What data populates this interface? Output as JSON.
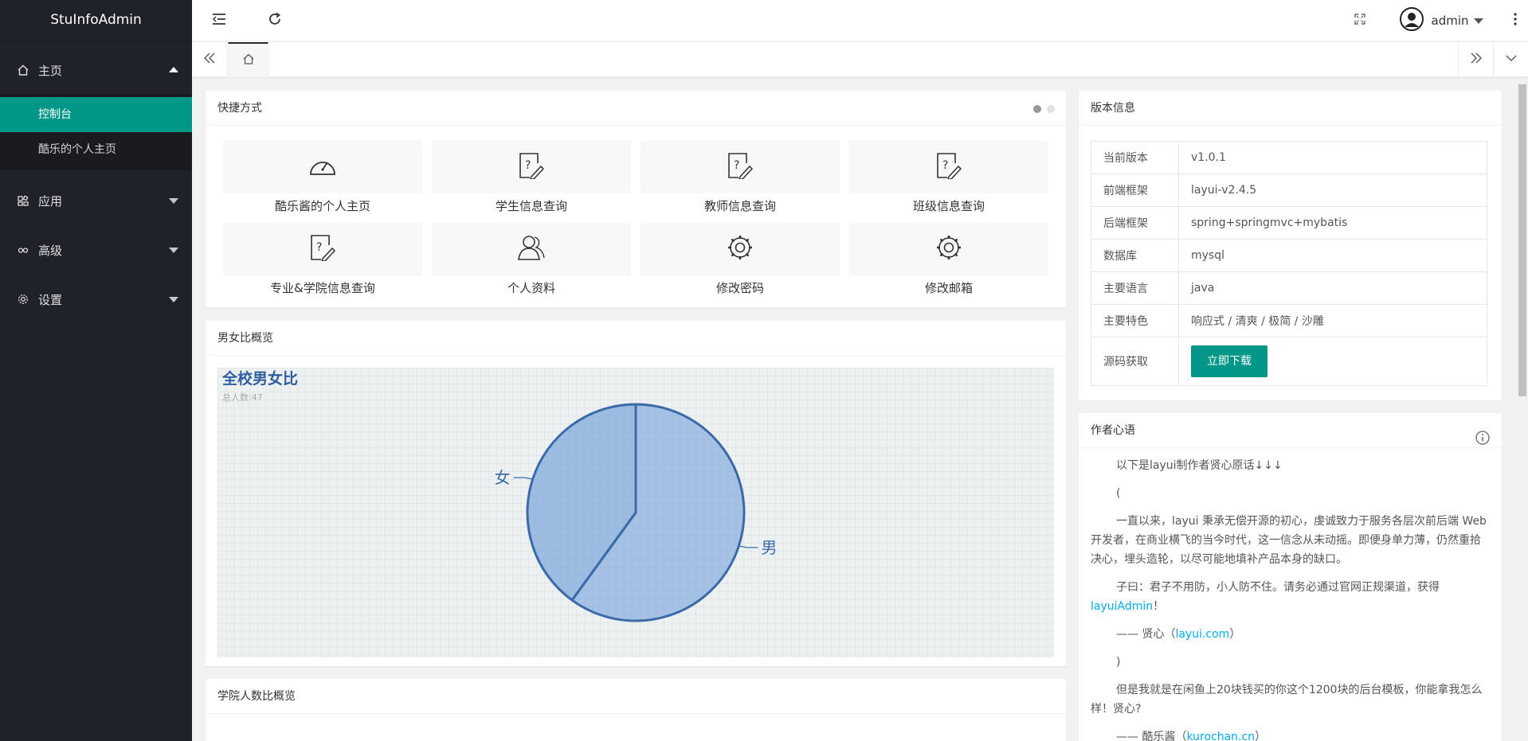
{
  "app": {
    "title": "StuInfoAdmin"
  },
  "sidebar": {
    "items": [
      {
        "label": "主页",
        "icon": "home-icon",
        "expanded": true,
        "children": [
          {
            "label": "控制台",
            "active": true
          },
          {
            "label": "酷乐的个人主页",
            "active": false
          }
        ]
      },
      {
        "label": "应用",
        "icon": "app-icon",
        "expanded": false
      },
      {
        "label": "高级",
        "icon": "senior-icon",
        "expanded": false
      },
      {
        "label": "设置",
        "icon": "gear-icon",
        "expanded": false
      }
    ]
  },
  "header": {
    "username": "admin"
  },
  "shortcuts": {
    "title": "快捷方式",
    "items": [
      {
        "label": "酷乐酱的个人主页",
        "icon": "gauge-icon"
      },
      {
        "label": "学生信息查询",
        "icon": "query-doc-icon"
      },
      {
        "label": "教师信息查询",
        "icon": "query-doc-icon"
      },
      {
        "label": "班级信息查询",
        "icon": "query-doc-icon"
      },
      {
        "label": "专业&学院信息查询",
        "icon": "query-doc-icon"
      },
      {
        "label": "个人资料",
        "icon": "user-icon"
      },
      {
        "label": "修改密码",
        "icon": "gear-icon"
      },
      {
        "label": "修改邮箱",
        "icon": "gear-icon"
      }
    ]
  },
  "gender_panel": {
    "title": "男女比概览"
  },
  "college_panel": {
    "title": "学院人数比概览"
  },
  "chart_data": {
    "type": "pie",
    "title": "全校男女比",
    "subtitle": "总人数:47",
    "slices": [
      {
        "label": "男",
        "percent": 60
      },
      {
        "label": "女",
        "percent": 40
      }
    ],
    "colors": {
      "fill": "#6a9bd8",
      "stroke": "#3a6aa8",
      "title": "#2f5f9e"
    }
  },
  "version": {
    "title": "版本信息",
    "rows": [
      {
        "key": "当前版本",
        "value": "v1.0.1"
      },
      {
        "key": "前端框架",
        "value": "layui-v2.4.5"
      },
      {
        "key": "后端框架",
        "value": "spring+springmvc+mybatis"
      },
      {
        "key": "数据库",
        "value": "mysql"
      },
      {
        "key": "主要语言",
        "value": "java"
      },
      {
        "key": "主要特色",
        "value": "响应式 / 清爽 / 极简 / 沙雕"
      }
    ],
    "download": {
      "key": "源码获取",
      "button": "立即下载"
    }
  },
  "author": {
    "title": "作者心语",
    "p1": "以下是layui制作者贤心原话↓↓↓",
    "p2": "(",
    "p3": "一直以来，layui 秉承无偿开源的初心，虔诚致力于服务各层次前后端 Web 开发者，在商业横飞的当今时代，这一信念从未动摇。即便身单力薄，仍然重拾决心，埋头造轮，以尽可能地填补产品本身的缺口。",
    "p4a": "子曰：君子不用防，小人防不住。请务必通过官网正规渠道，获得 ",
    "p4link": "layuiAdmin",
    "p4b": "！",
    "p5a": "—— 贤心（",
    "p5link": "layui.com",
    "p5b": "）",
    "p6": ")",
    "p7": "但是我就是在闲鱼上20块钱买的你这个1200块的后台模板，你能拿我怎么样！贤心?",
    "p8a": "—— 酷乐酱（",
    "p8link": "kurochan.cn",
    "p8b": "）"
  },
  "colors": {
    "accent": "#009688",
    "sidebar": "#20222a",
    "link": "#01aaed"
  }
}
